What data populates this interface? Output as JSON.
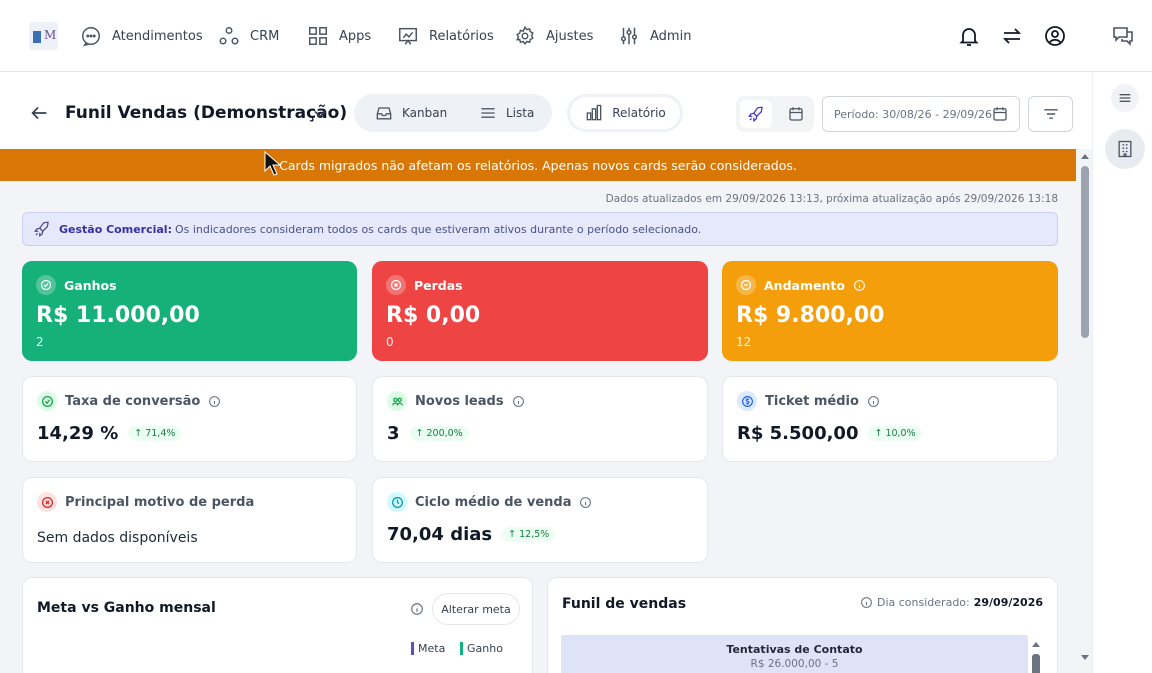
{
  "nav": {
    "items": [
      {
        "label": "Atendimentos",
        "icon": "chat-bubble-icon"
      },
      {
        "label": "CRM",
        "icon": "network-icon"
      },
      {
        "label": "Apps",
        "icon": "grid-icon"
      },
      {
        "label": "Relatórios",
        "icon": "chart-board-icon"
      },
      {
        "label": "Ajustes",
        "icon": "gear-icon"
      },
      {
        "label": "Admin",
        "icon": "sliders-icon"
      }
    ],
    "right_icons": [
      "bell-icon",
      "swap-arrows-icon",
      "user-circle-icon",
      "chat-icon"
    ]
  },
  "header": {
    "title": "Funil Vendas (Demonstração)",
    "views": {
      "kanban": "Kanban",
      "lista": "Lista",
      "relatorio": "Relatório"
    },
    "period": "Período: 30/08/26 - 29/09/26"
  },
  "banner": {
    "text": "Cards migrados não afetam os relatórios. Apenas novos cards serão considerados.",
    "color": "#d97706"
  },
  "updated_text": "Dados atualizados em 29/09/2026 13:13, próxima atualização após 29/09/2026 13:18",
  "info_bar": {
    "bold": "Gestão Comercial:",
    "text": "Os indicadores consideram todos os cards que estiveram ativos durante o período selecionado."
  },
  "summary_cards": {
    "ganhos": {
      "label": "Ganhos",
      "value": "R$ 11.000,00",
      "count": "2",
      "color": "#16b07a"
    },
    "perdas": {
      "label": "Perdas",
      "value": "R$ 0,00",
      "count": "0",
      "color": "#ef4444"
    },
    "andamento": {
      "label": "Andamento",
      "value": "R$ 9.800,00",
      "count": "12",
      "color": "#f59e0b"
    }
  },
  "kpis": {
    "taxa": {
      "label": "Taxa de conversão",
      "value": "14,29 %",
      "delta": "71,4%"
    },
    "leads": {
      "label": "Novos leads",
      "value": "3",
      "delta": "200,0%"
    },
    "ticket": {
      "label": "Ticket médio",
      "value": "R$ 5.500,00",
      "delta": "10,0%"
    },
    "motivo": {
      "label": "Principal motivo de perda",
      "value": "Sem dados disponíveis"
    },
    "ciclo": {
      "label": "Ciclo médio de venda",
      "value": "70,04 dias",
      "delta": "12,5%"
    }
  },
  "meta_panel": {
    "title": "Meta vs Ganho mensal",
    "button": "Alterar meta",
    "legend": [
      {
        "name": "Meta",
        "color": "#5b4fc7"
      },
      {
        "name": "Ganho",
        "color": "#16b07a"
      }
    ]
  },
  "funnel_panel": {
    "title": "Funil de vendas",
    "date_label": "Dia considerado:",
    "date": "29/09/2026",
    "stage_name": "Tentativas de Contato",
    "stage_value": "R$ 26.000,00 - 5"
  }
}
